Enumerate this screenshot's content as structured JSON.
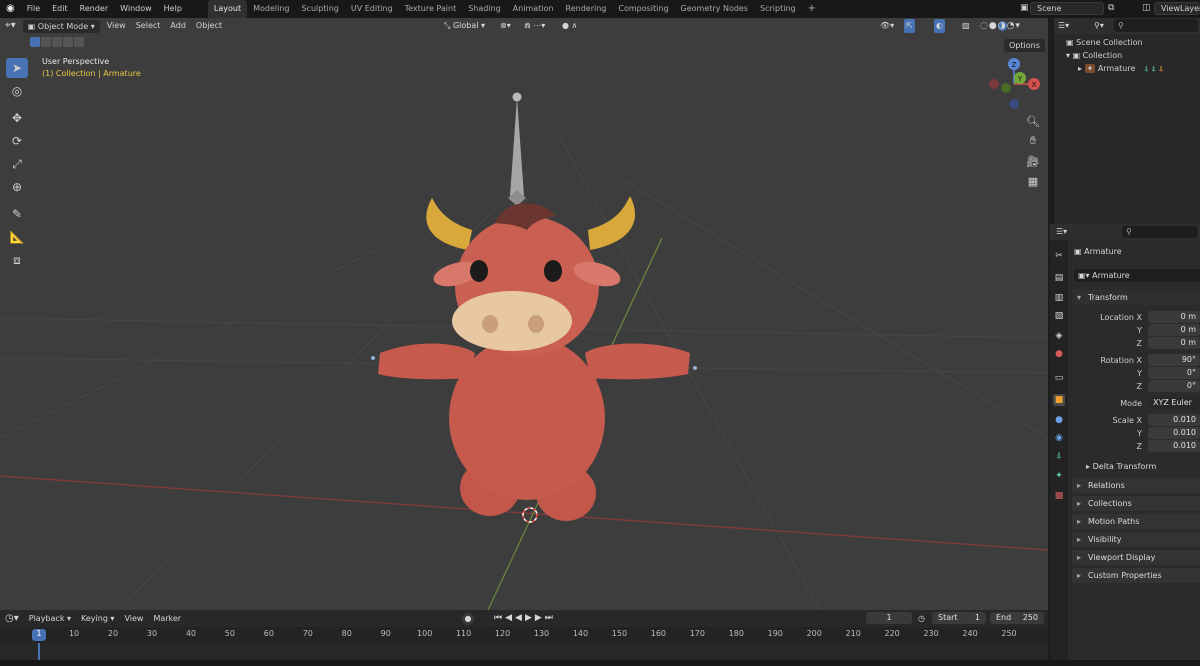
{
  "menu": [
    "File",
    "Edit",
    "Render",
    "Window",
    "Help"
  ],
  "workspaces": [
    "Layout",
    "Modeling",
    "Sculpting",
    "UV Editing",
    "Texture Paint",
    "Shading",
    "Animation",
    "Rendering",
    "Compositing",
    "Geometry Nodes",
    "Scripting"
  ],
  "active_workspace": "Layout",
  "scene_name": "Scene",
  "view_layer": "ViewLayer",
  "viewport": {
    "mode": "Object Mode",
    "menus": [
      "View",
      "Select",
      "Add",
      "Object"
    ],
    "orientation": "Global",
    "options_label": "Options",
    "perspective": "User Perspective",
    "collection_prefix": "(1) Collection |",
    "active_object": "Armature"
  },
  "gizmo": {
    "x": "X",
    "y": "Y",
    "z": "Z"
  },
  "outliner": {
    "root": "Scene Collection",
    "collection": "Collection",
    "object": "Armature"
  },
  "properties": {
    "object_name": "Armature",
    "data_name": "Armature",
    "transform_label": "Transform",
    "location": {
      "label": "Location X",
      "x": "0 m",
      "y": "0 m",
      "z": "0 m"
    },
    "rotation": {
      "label": "Rotation X",
      "x": "90°",
      "y": "0°",
      "z": "0°"
    },
    "mode": {
      "label": "Mode",
      "value": "XYZ Euler"
    },
    "scale": {
      "label": "Scale X",
      "x": "0.010",
      "y": "0.010",
      "z": "0.010"
    },
    "axis_y": "Y",
    "axis_z": "Z",
    "delta_transform": "Delta Transform",
    "panels": [
      "Relations",
      "Collections",
      "Motion Paths",
      "Visibility",
      "Viewport Display",
      "Custom Properties"
    ]
  },
  "timeline": {
    "menus": [
      "Playback",
      "Keying",
      "View",
      "Marker"
    ],
    "current_frame": "1",
    "start_label": "Start",
    "start_value": "1",
    "end_label": "End",
    "end_value": "250",
    "ticks": [
      "1",
      "10",
      "20",
      "30",
      "40",
      "50",
      "60",
      "70",
      "80",
      "90",
      "100",
      "110",
      "120",
      "130",
      "140",
      "150",
      "160",
      "170",
      "180",
      "190",
      "200",
      "210",
      "220",
      "230",
      "240",
      "250"
    ]
  }
}
